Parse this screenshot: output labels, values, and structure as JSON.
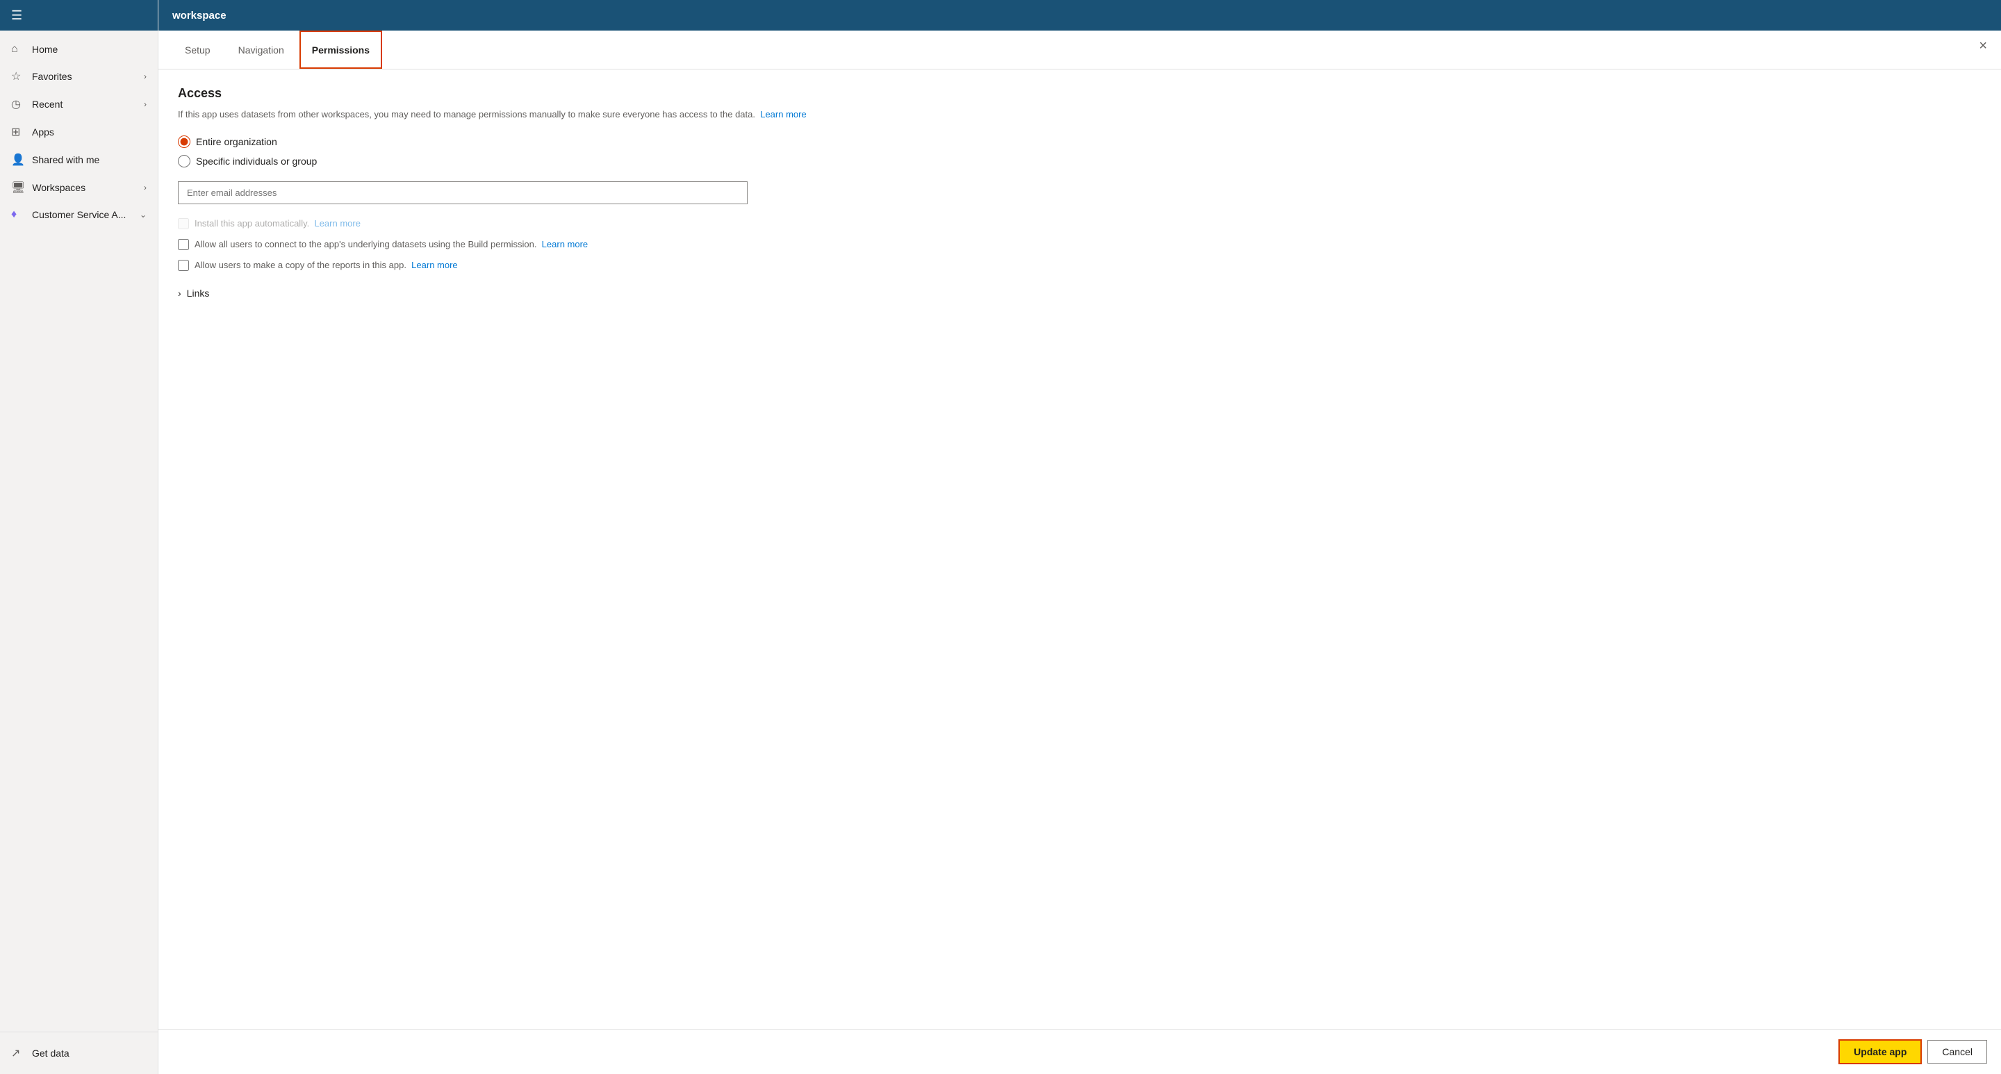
{
  "app_title": "workspace",
  "sidebar": {
    "items": [
      {
        "id": "home",
        "label": "Home",
        "icon": "⌂",
        "hasChevron": false
      },
      {
        "id": "favorites",
        "label": "Favorites",
        "icon": "★",
        "hasChevron": true
      },
      {
        "id": "recent",
        "label": "Recent",
        "icon": "🕐",
        "hasChevron": true
      },
      {
        "id": "apps",
        "label": "Apps",
        "icon": "⊞",
        "hasChevron": false
      },
      {
        "id": "shared-with-me",
        "label": "Shared with me",
        "icon": "👥",
        "hasChevron": false
      },
      {
        "id": "workspaces",
        "label": "Workspaces",
        "icon": "🖥",
        "hasChevron": true
      },
      {
        "id": "customer-service",
        "label": "Customer Service A...",
        "icon": "💜",
        "hasChevron": true
      }
    ],
    "footer": {
      "get_data_label": "Get data"
    }
  },
  "tabs": [
    {
      "id": "setup",
      "label": "Setup",
      "active": false
    },
    {
      "id": "navigation",
      "label": "Navigation",
      "active": false
    },
    {
      "id": "permissions",
      "label": "Permissions",
      "active": true
    }
  ],
  "dialog": {
    "close_label": "×",
    "access": {
      "title": "Access",
      "description": "If this app uses datasets from other workspaces, you may need to manage permissions manually to make sure everyone has access to the data.",
      "learn_more_label": "Learn more",
      "radio_options": [
        {
          "id": "entire-org",
          "label": "Entire organization",
          "checked": true
        },
        {
          "id": "specific-individuals",
          "label": "Specific individuals or group",
          "checked": false
        }
      ],
      "email_placeholder": "Enter email addresses",
      "checkboxes": [
        {
          "id": "install-auto",
          "label": "Install this app automatically.",
          "learn_more": "Learn more",
          "checked": false,
          "disabled": true
        },
        {
          "id": "allow-build",
          "label": "Allow all users to connect to the app's underlying datasets using the Build permission.",
          "learn_more": "Learn more",
          "checked": false,
          "disabled": false
        },
        {
          "id": "allow-copy",
          "label": "Allow users to make a copy of the reports in this app.",
          "learn_more": "Learn more",
          "checked": false,
          "disabled": false
        }
      ]
    },
    "links": {
      "label": "Links"
    }
  },
  "footer": {
    "update_button_label": "Update app",
    "cancel_button_label": "Cancel"
  }
}
